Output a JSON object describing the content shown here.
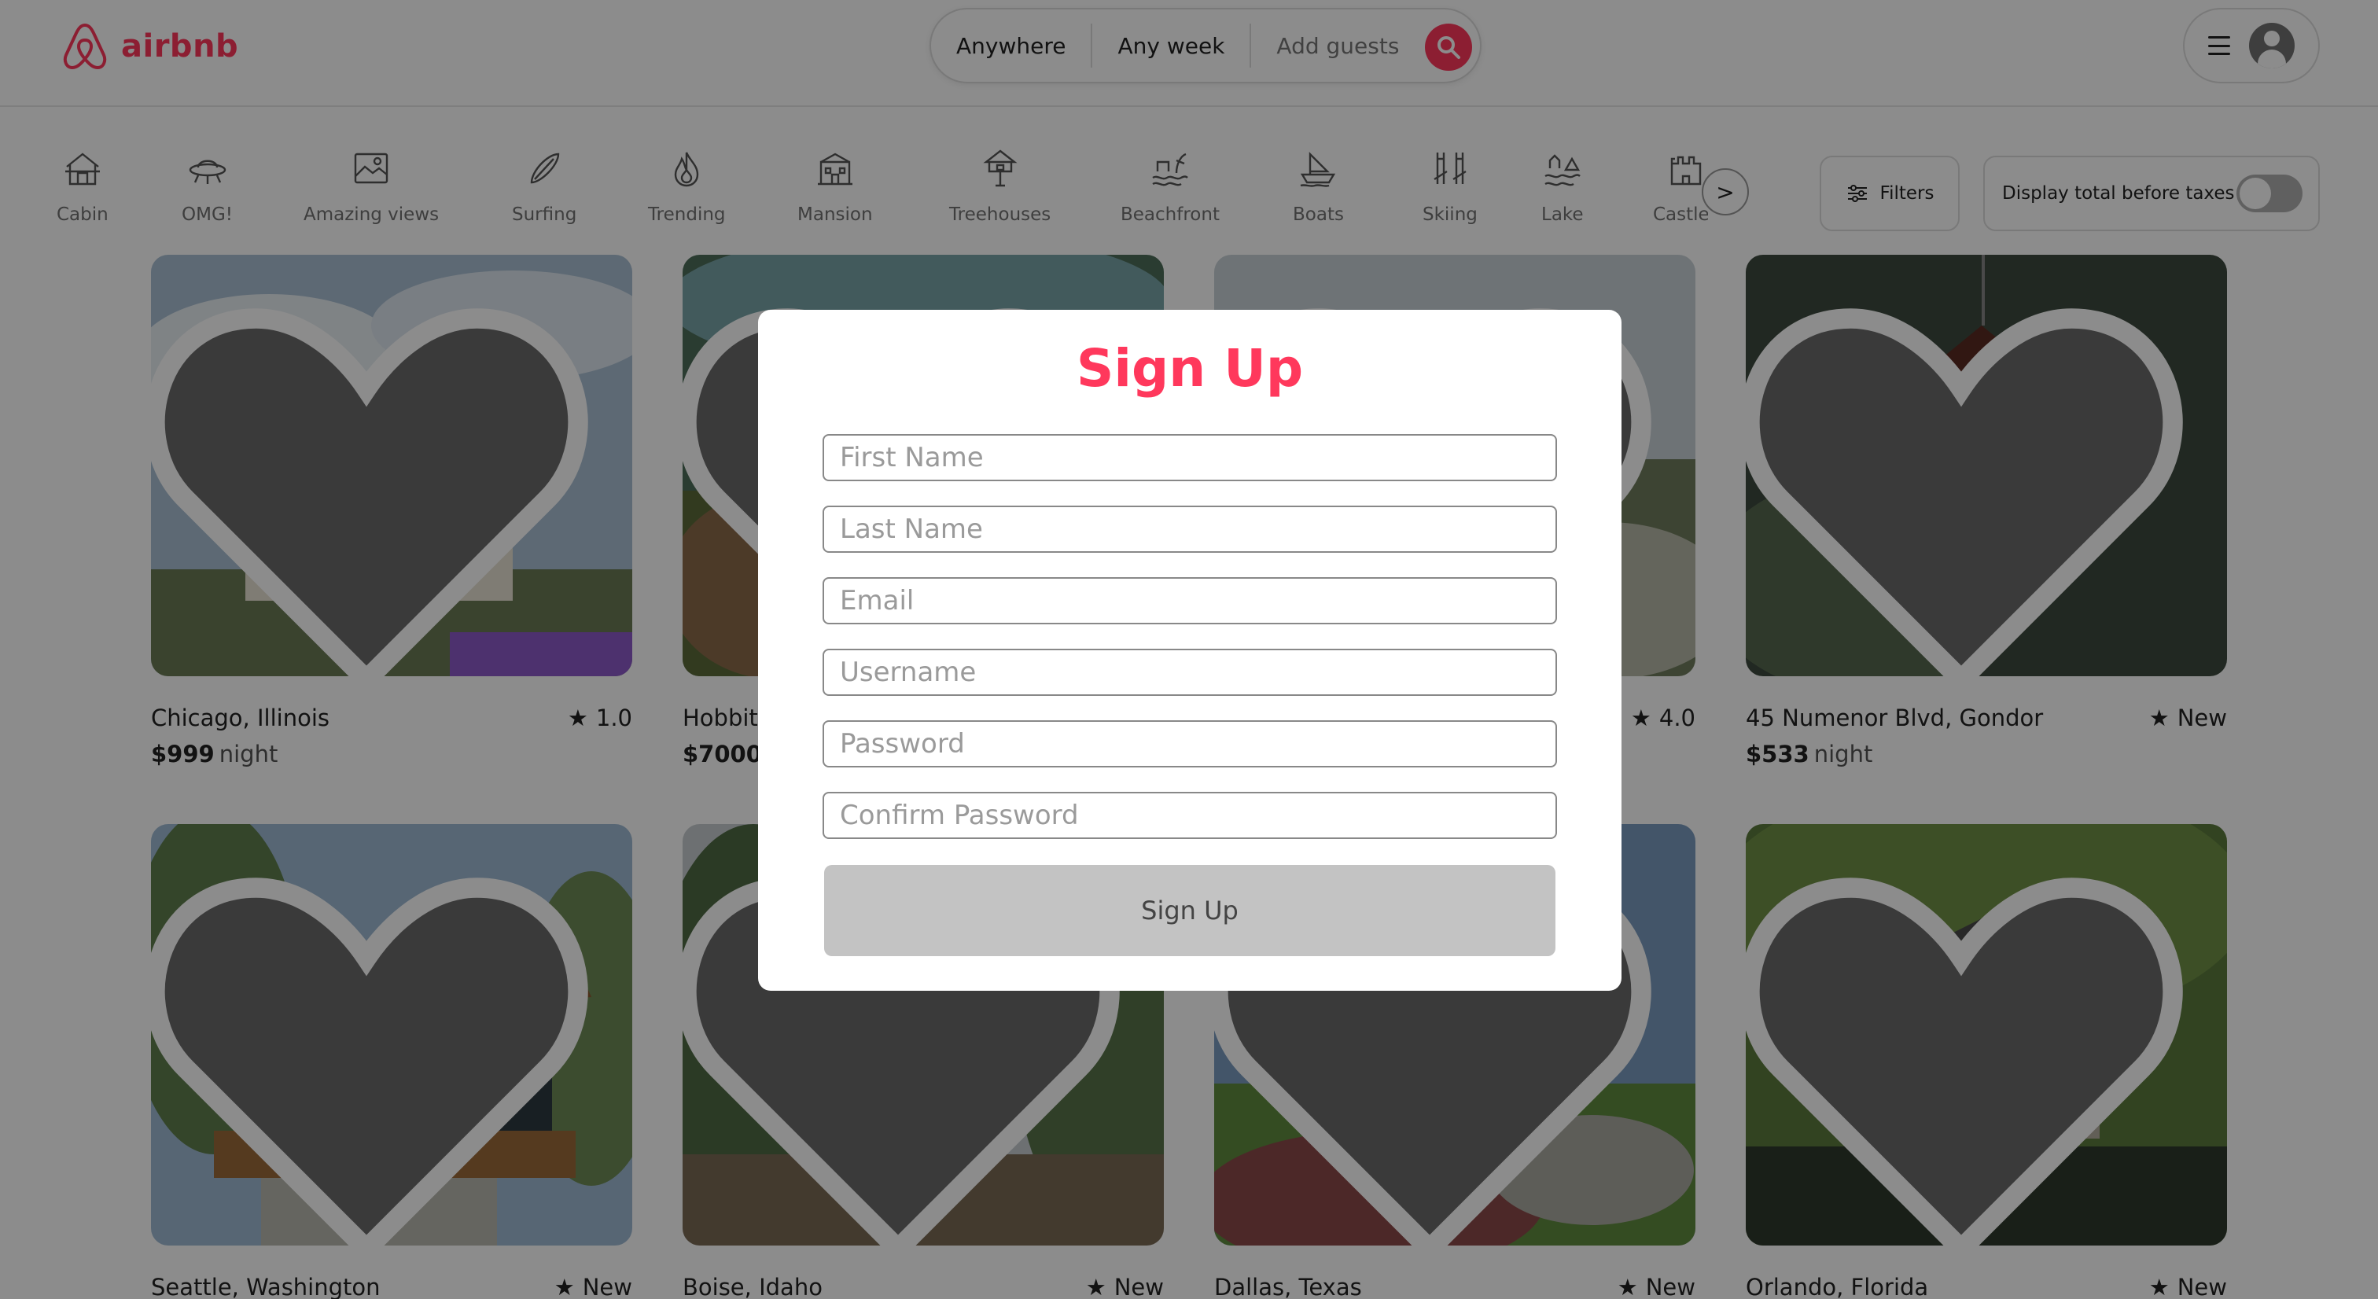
{
  "header": {
    "logo_text": "airbnb",
    "search": {
      "anywhere": "Anywhere",
      "any_week": "Any week",
      "add_guests": "Add guests"
    }
  },
  "categories": [
    {
      "label": "Cabin",
      "icon": "cabin-icon"
    },
    {
      "label": "OMG!",
      "icon": "ufo-icon"
    },
    {
      "label": "Amazing views",
      "icon": "views-icon"
    },
    {
      "label": "Surfing",
      "icon": "surfboard-icon"
    },
    {
      "label": "Trending",
      "icon": "flame-icon"
    },
    {
      "label": "Mansion",
      "icon": "mansion-icon"
    },
    {
      "label": "Treehouses",
      "icon": "treehouse-icon"
    },
    {
      "label": "Beachfront",
      "icon": "beach-icon"
    },
    {
      "label": "Boats",
      "icon": "boat-icon"
    },
    {
      "label": "Skiing",
      "icon": "ski-icon"
    },
    {
      "label": "Lake",
      "icon": "lake-icon"
    },
    {
      "label": "Castles",
      "icon": "castle-icon"
    }
  ],
  "category_next": ">",
  "filters_label": "Filters",
  "taxes_label": "Display total before taxes",
  "listings": [
    {
      "location": "Chicago, Illinois",
      "rating": "1.0",
      "price": "$999",
      "unit": "night"
    },
    {
      "location": "Hobbit",
      "rating": "",
      "price": "$7000",
      "unit": ""
    },
    {
      "location": "",
      "rating": "4.0",
      "price": "",
      "unit": ""
    },
    {
      "location": "45 Numenor Blvd, Gondor",
      "rating": "New",
      "price": "$533",
      "unit": "night"
    },
    {
      "location": "Seattle, Washington",
      "rating": "New",
      "price": "",
      "unit": ""
    },
    {
      "location": "Boise, Idaho",
      "rating": "New",
      "price": "",
      "unit": ""
    },
    {
      "location": "Dallas, Texas",
      "rating": "New",
      "price": "",
      "unit": ""
    },
    {
      "location": "Orlando, Florida",
      "rating": "New",
      "price": "",
      "unit": ""
    }
  ],
  "modal": {
    "title": "Sign Up",
    "placeholders": {
      "first_name": "First Name",
      "last_name": "Last Name",
      "email": "Email",
      "username": "Username",
      "password": "Password",
      "confirm_password": "Confirm Password"
    },
    "submit_label": "Sign Up"
  },
  "colors": {
    "brand": "#ff385c",
    "overlay": "rgba(0,0,0,0.45)",
    "button_disabled": "#c3c3c3"
  }
}
